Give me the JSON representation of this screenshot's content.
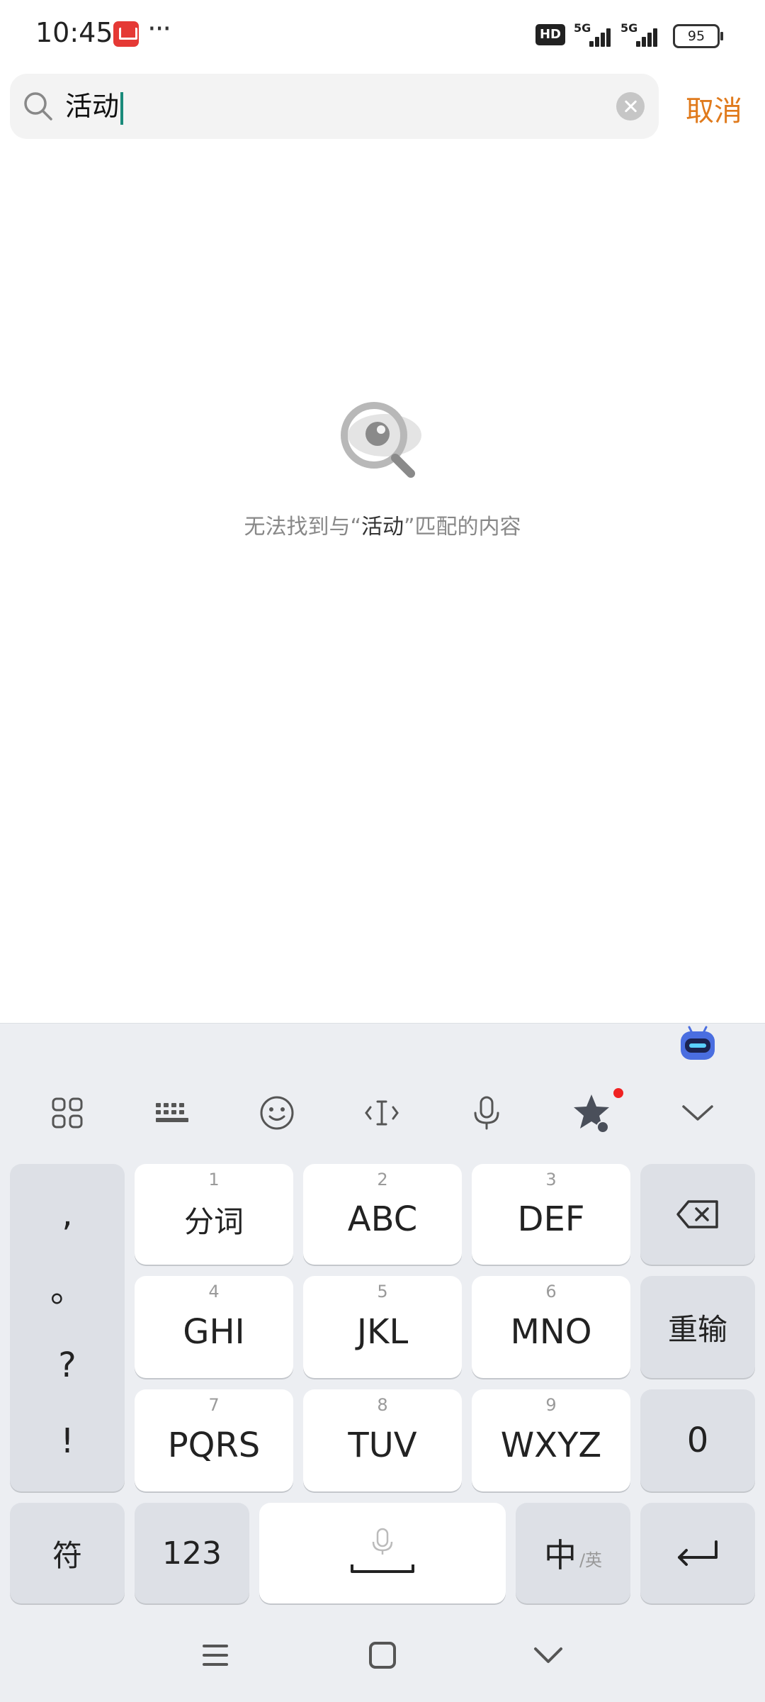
{
  "status_bar": {
    "time": "10:45",
    "more": "···",
    "hd": "HD",
    "network1": "5G",
    "network2": "5G",
    "battery": "95"
  },
  "search": {
    "value": "活动",
    "cancel_label": "取消"
  },
  "empty_state": {
    "prefix": "无法找到与“",
    "keyword": "活动",
    "suffix": "”匹配的内容"
  },
  "keyboard": {
    "toolbar_icons": [
      "grid-icon",
      "keyboard-icon",
      "emoji-icon",
      "cursor-icon",
      "microphone-icon",
      "star-icon",
      "chevron-down-icon"
    ],
    "punctuation": [
      ",",
      "。",
      "?",
      "!"
    ],
    "keys": [
      {
        "num": "1",
        "label": "分词"
      },
      {
        "num": "2",
        "label": "ABC"
      },
      {
        "num": "3",
        "label": "DEF"
      },
      {
        "num": "4",
        "label": "GHI"
      },
      {
        "num": "5",
        "label": "JKL"
      },
      {
        "num": "6",
        "label": "MNO"
      },
      {
        "num": "7",
        "label": "PQRS"
      },
      {
        "num": "8",
        "label": "TUV"
      },
      {
        "num": "9",
        "label": "WXYZ"
      }
    ],
    "retype_label": "重输",
    "zero_label": "0",
    "symbol_label": "符",
    "numeric_label": "123",
    "lang_primary": "中",
    "lang_secondary": "/英"
  },
  "colors": {
    "accent": "#e07a1c",
    "caret": "#1a8a7a",
    "keyboard_bg": "#eceef2"
  }
}
